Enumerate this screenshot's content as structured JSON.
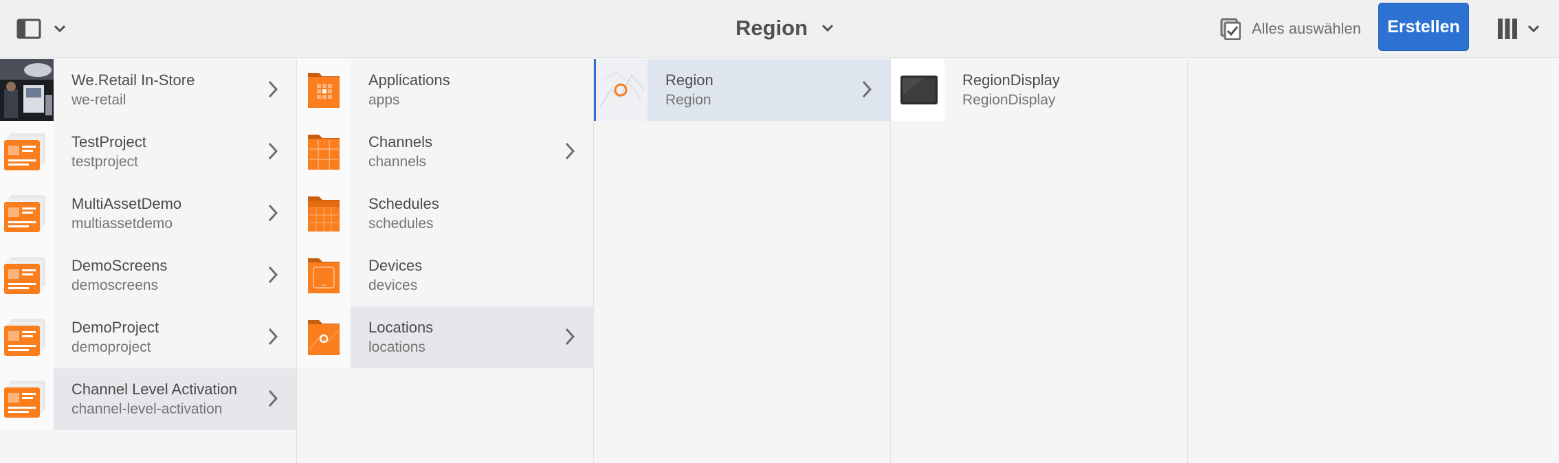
{
  "header": {
    "title": "Region",
    "select_all_label": "Alles auswählen",
    "create_label": "Erstellen"
  },
  "colors": {
    "accent": "#2d72d2",
    "folder_orange": "#fa7d1e",
    "selected_row": "#e5e7ea"
  },
  "columns": [
    {
      "items": [
        {
          "title": "We.Retail In-Store",
          "subtitle": "we-retail",
          "icon": "photo-thumbnail",
          "has_children": true
        },
        {
          "title": "TestProject",
          "subtitle": "testproject",
          "icon": "project-icon",
          "has_children": true
        },
        {
          "title": "MultiAssetDemo",
          "subtitle": "multiassetdemo",
          "icon": "project-icon",
          "has_children": true
        },
        {
          "title": "DemoScreens",
          "subtitle": "demoscreens",
          "icon": "project-icon",
          "has_children": true
        },
        {
          "title": "DemoProject",
          "subtitle": "demoproject",
          "icon": "project-icon",
          "has_children": true
        },
        {
          "title": "Channel Level Activation",
          "subtitle": "channel-level-activation",
          "icon": "project-icon",
          "has_children": true,
          "selected": true
        }
      ]
    },
    {
      "items": [
        {
          "title": "Applications",
          "subtitle": "apps",
          "icon": "applications-folder-icon",
          "has_children": false
        },
        {
          "title": "Channels",
          "subtitle": "channels",
          "icon": "channels-folder-icon",
          "has_children": true
        },
        {
          "title": "Schedules",
          "subtitle": "schedules",
          "icon": "schedules-folder-icon",
          "has_children": false
        },
        {
          "title": "Devices",
          "subtitle": "devices",
          "icon": "devices-folder-icon",
          "has_children": false
        },
        {
          "title": "Locations",
          "subtitle": "locations",
          "icon": "locations-folder-icon",
          "has_children": true,
          "selected": true
        }
      ]
    },
    {
      "items": [
        {
          "title": "Region",
          "subtitle": "Region",
          "icon": "map-pin-icon",
          "has_children": true,
          "active": true
        }
      ]
    },
    {
      "items": [
        {
          "title": "RegionDisplay",
          "subtitle": "RegionDisplay",
          "icon": "display-icon",
          "has_children": false
        }
      ]
    }
  ]
}
